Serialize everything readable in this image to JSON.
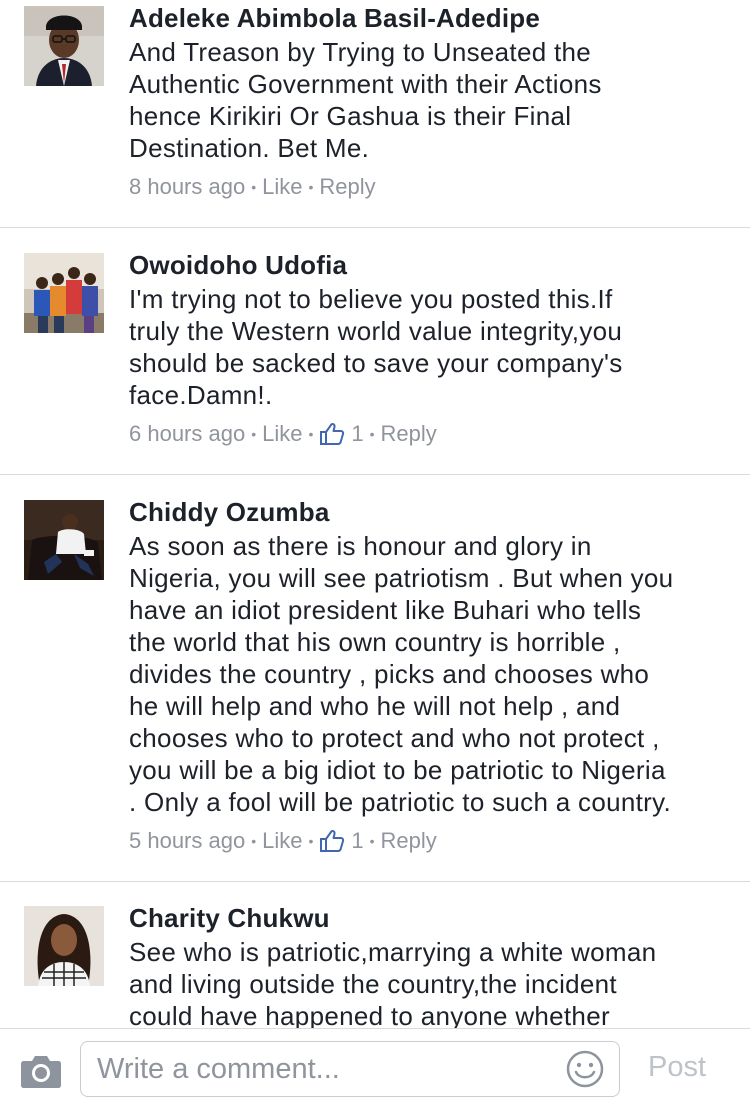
{
  "comments": [
    {
      "author": "Adeleke Abimbola Basil-Adedipe",
      "lines": [
        "And Treason by Trying to Unseated the",
        "Authentic Government with their Actions",
        "hence Kirikiri Or Gashua is their Final",
        "Destination. Bet Me."
      ],
      "time": "8 hours ago",
      "like_label": "Like",
      "reply_label": "Reply",
      "like_count": ""
    },
    {
      "author": "Owoidoho Udofia",
      "lines": [
        "I'm trying not to believe you posted this.If",
        "truly the Western world value integrity,you",
        "should be sacked to save your company's",
        "face.Damn!."
      ],
      "time": "6 hours ago",
      "like_label": "Like",
      "reply_label": "Reply",
      "like_count": "1"
    },
    {
      "author": "Chiddy Ozumba",
      "lines": [
        "As soon as there is honour and glory in",
        "Nigeria, you will see patriotism . But when you",
        "have an idiot president like Buhari who tells",
        "the world that his own country is horrible ,",
        "divides the country , picks and chooses who",
        "he will help and who he will not help , and",
        "chooses who to protect and who not protect ,",
        "you will be a big idiot to be patriotic to Nigeria",
        ". Only a fool will be patriotic to such a country."
      ],
      "time": "5 hours ago",
      "like_label": "Like",
      "reply_label": "Reply",
      "like_count": "1"
    },
    {
      "author": "Charity Chukwu",
      "lines": [
        "See who is patriotic,marrying a white woman",
        "and living outside the country,the incident",
        "could have happened to anyone whether"
      ]
    }
  ],
  "composer": {
    "placeholder": "Write a comment...",
    "post_label": "Post",
    "camera_icon": "camera-icon",
    "emoji_icon": "smiley-icon"
  },
  "colors": {
    "text": "#1d2129",
    "meta": "#90949c",
    "divider": "#d9dadc",
    "post_disabled": "#bec3c9"
  }
}
